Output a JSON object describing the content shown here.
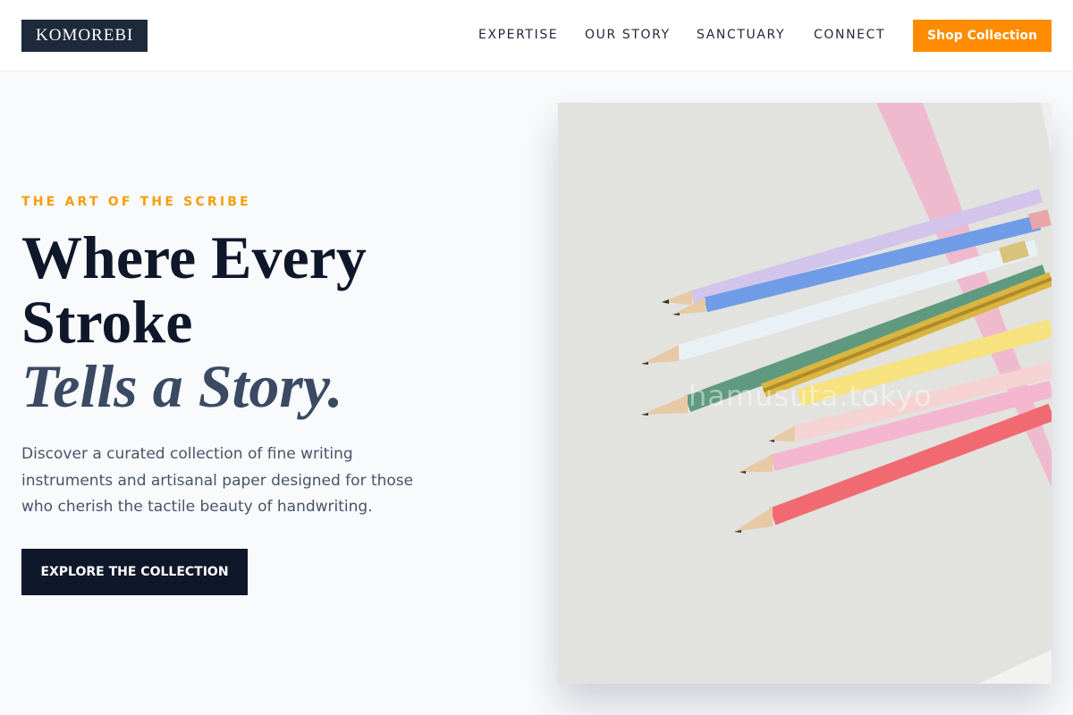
{
  "header": {
    "logo": "KOMOREBI",
    "nav": [
      "EXPERTISE",
      "OUR STORY",
      "SANCTUARY",
      "CONNECT"
    ],
    "shop_button": "Shop Collection"
  },
  "hero": {
    "eyebrow": "THE ART OF THE SCRIBE",
    "headline_line1": "Where Every",
    "headline_line2": "Stroke",
    "headline_line3": "Tells a Story.",
    "lead": "Discover a curated collection of fine writing instruments and artisanal paper designed for those who cherish the tactile beauty of handwriting.",
    "cta": "EXPLORE THE COLLECTION"
  },
  "image": {
    "watermark": "hamusuta.tokyo",
    "icon": "colored-pencils-photo"
  },
  "colors": {
    "accent": "#ff8c00",
    "eyebrow": "#f59e0b",
    "dark": "#0f172a",
    "logo_bg": "#1e293b"
  }
}
